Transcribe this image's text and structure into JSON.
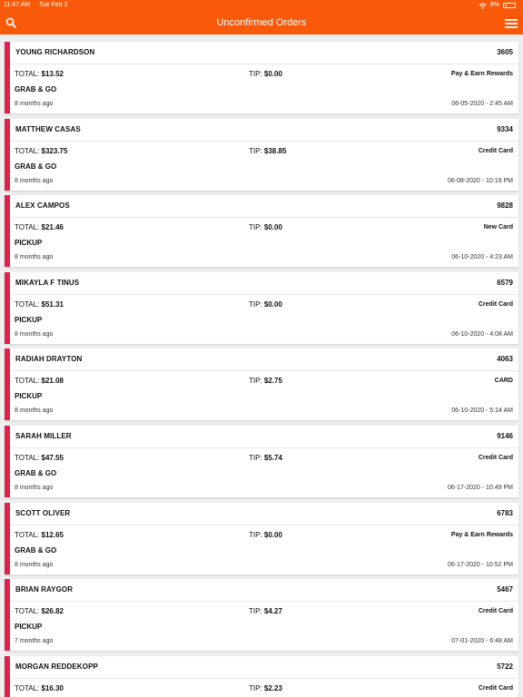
{
  "status": {
    "time": "11:47 AM",
    "date": "Tue Feb 2",
    "battery": "9%"
  },
  "header": {
    "title": "Unconfirmed Orders"
  },
  "orders": [
    {
      "name": "YOUNG RICHARDSON",
      "number": "3605",
      "total": "$13.52",
      "tip": "$0.00",
      "payment": "Pay & Earn Rewards",
      "type": "GRAB & GO",
      "ago": "8 months ago",
      "date": "06-05-2020 - 2:45 AM"
    },
    {
      "name": "MATTHEW CASAS",
      "number": "9334",
      "total": "$323.75",
      "tip": "$38.85",
      "payment": "Credit Card",
      "type": "GRAB & GO",
      "ago": "8 months ago",
      "date": "06-08-2020 - 10:19 PM"
    },
    {
      "name": "ALEX CAMPOS",
      "number": "9828",
      "total": "$21.46",
      "tip": "$0.00",
      "payment": "New Card",
      "type": "PICKUP",
      "ago": "8 months ago",
      "date": "06-10-2020 - 4:23 AM"
    },
    {
      "name": "MIKAYLA F TINUS",
      "number": "6579",
      "total": "$51.31",
      "tip": "$0.00",
      "payment": "Credit Card",
      "type": "PICKUP",
      "ago": "8 months ago",
      "date": "06-10-2020 - 4:08 AM"
    },
    {
      "name": "RADIAH DRAYTON",
      "number": "4063",
      "total": "$21.08",
      "tip": "$2.75",
      "payment": "CARD",
      "type": "PICKUP",
      "ago": "8 months ago",
      "date": "06-10-2020 - 5:14 AM"
    },
    {
      "name": "SARAH MILLER",
      "number": "9146",
      "total": "$47.55",
      "tip": "$5.74",
      "payment": "Credit Card",
      "type": "GRAB & GO",
      "ago": "8 months ago",
      "date": "06-17-2020 - 10:49 PM"
    },
    {
      "name": "SCOTT OLIVER",
      "number": "6783",
      "total": "$12.65",
      "tip": "$0.00",
      "payment": "Pay & Earn Rewards",
      "type": "GRAB & GO",
      "ago": "8 months ago",
      "date": "06-17-2020 - 10:52 PM"
    },
    {
      "name": "BRIAN RAYGOR",
      "number": "5467",
      "total": "$26.82",
      "tip": "$4.27",
      "payment": "Credit Card",
      "type": "PICKUP",
      "ago": "7 months ago",
      "date": "07-01-2020 - 6:48 AM"
    },
    {
      "name": "MORGAN REDDEKOPP",
      "number": "5722",
      "total": "$16.30",
      "tip": "$2.23",
      "payment": "Credit Card",
      "type": "",
      "ago": "",
      "date": ""
    }
  ],
  "labels": {
    "total": "TOTAL:",
    "tip": "TIP:"
  },
  "colors": {
    "header": "#f85a0a",
    "accent": "#e0224b"
  }
}
